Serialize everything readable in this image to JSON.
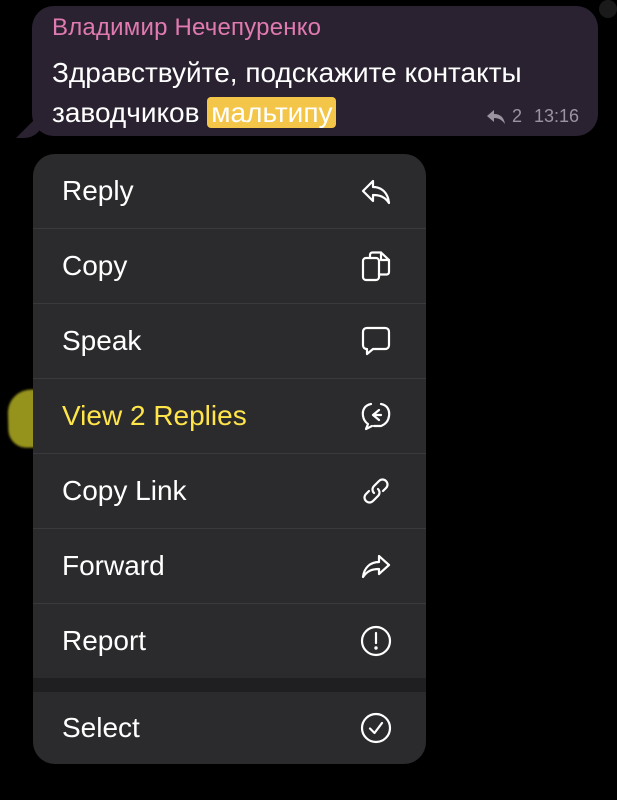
{
  "message": {
    "sender": "Владимир Нечепуренко",
    "text_before": "Здравствуйте, подскажите контакты заводчиков ",
    "highlight": "мальтипу",
    "replies_count": "2",
    "time": "13:16"
  },
  "menu": {
    "items": [
      {
        "label": "Reply",
        "icon": "reply-icon"
      },
      {
        "label": "Copy",
        "icon": "copy-icon"
      },
      {
        "label": "Speak",
        "icon": "speech-bubble-icon"
      },
      {
        "label": "View 2 Replies",
        "icon": "thread-replies-icon"
      },
      {
        "label": "Copy Link",
        "icon": "link-icon"
      },
      {
        "label": "Forward",
        "icon": "forward-icon"
      },
      {
        "label": "Report",
        "icon": "exclamation-circle-icon"
      },
      {
        "label": "Select",
        "icon": "checkmark-circle-icon"
      }
    ]
  },
  "colors": {
    "sender": "#e07ab0",
    "highlight_bg": "#f3c64a",
    "menu_bg": "#2b2b2d",
    "highlighted_item_text": "#ffe54a",
    "marker": "#c9c526"
  }
}
